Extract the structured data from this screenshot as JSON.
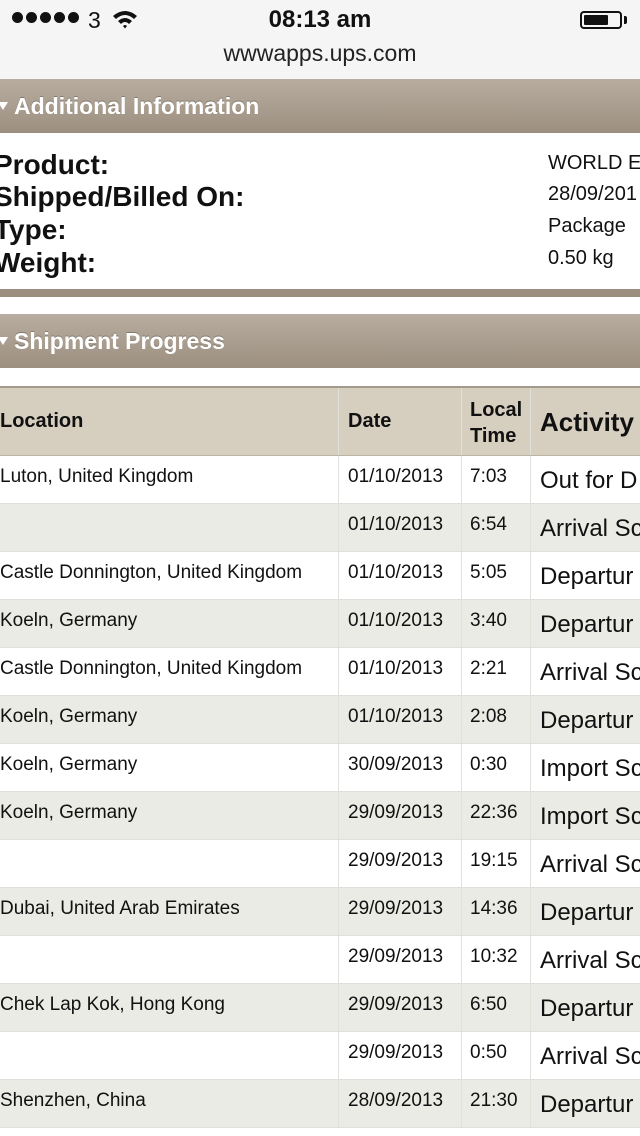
{
  "status_bar": {
    "carrier": "3",
    "time": "08:13 am"
  },
  "browser": {
    "url": "wwwapps.ups.com"
  },
  "additional_info": {
    "title": "Additional Information",
    "rows": [
      {
        "label": "Product:",
        "value": "WORLD E"
      },
      {
        "label": "Shipped/Billed On:",
        "value": "28/09/201"
      },
      {
        "label": "Type:",
        "value": "Package"
      },
      {
        "label": "Weight:",
        "value": "0.50 kg"
      }
    ]
  },
  "shipment_progress": {
    "title": "Shipment Progress",
    "columns": {
      "location": "Location",
      "date": "Date",
      "time_line1": "Local",
      "time_line2": "Time",
      "activity": "Activity"
    },
    "rows": [
      {
        "location": "Luton, United Kingdom",
        "date": "01/10/2013",
        "time": "7:03",
        "activity": "Out for D"
      },
      {
        "location": "",
        "date": "01/10/2013",
        "time": "6:54",
        "activity": "Arrival Sc"
      },
      {
        "location": "Castle Donnington, United Kingdom",
        "date": "01/10/2013",
        "time": "5:05",
        "activity": "Departur"
      },
      {
        "location": "Koeln, Germany",
        "date": "01/10/2013",
        "time": "3:40",
        "activity": "Departur"
      },
      {
        "location": "Castle Donnington, United Kingdom",
        "date": "01/10/2013",
        "time": "2:21",
        "activity": "Arrival Sc"
      },
      {
        "location": "Koeln, Germany",
        "date": "01/10/2013",
        "time": "2:08",
        "activity": "Departur"
      },
      {
        "location": "Koeln, Germany",
        "date": "30/09/2013",
        "time": "0:30",
        "activity": "Import Sc"
      },
      {
        "location": "Koeln, Germany",
        "date": "29/09/2013",
        "time": "22:36",
        "activity": "Import Sc"
      },
      {
        "location": "",
        "date": "29/09/2013",
        "time": "19:15",
        "activity": "Arrival Sc"
      },
      {
        "location": "Dubai, United Arab Emirates",
        "date": "29/09/2013",
        "time": "14:36",
        "activity": "Departur"
      },
      {
        "location": "",
        "date": "29/09/2013",
        "time": "10:32",
        "activity": "Arrival Sc"
      },
      {
        "location": "Chek Lap Kok, Hong Kong",
        "date": "29/09/2013",
        "time": "6:50",
        "activity": "Departur"
      },
      {
        "location": "",
        "date": "29/09/2013",
        "time": "0:50",
        "activity": "Arrival Sc"
      },
      {
        "location": "Shenzhen, China",
        "date": "28/09/2013",
        "time": "21:30",
        "activity": "Departur"
      }
    ]
  }
}
